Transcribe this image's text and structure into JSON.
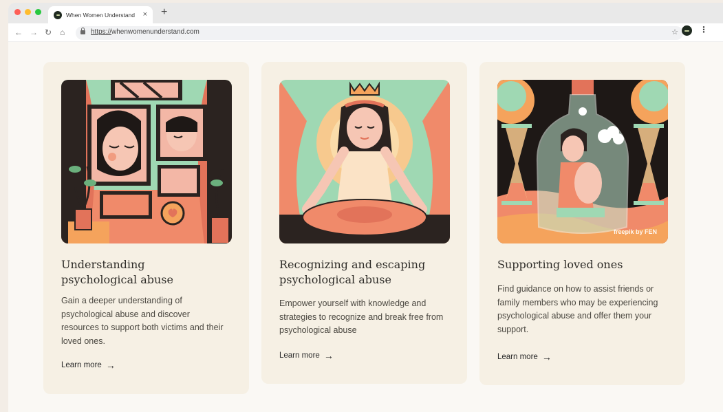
{
  "browser": {
    "tab_title": "When Women Understand",
    "tab_close": "×",
    "new_tab": "+",
    "url_scheme": "https://",
    "url_host": "whenwomenunderstand.com",
    "nav": {
      "back": "←",
      "forward": "→",
      "reload": "↻",
      "home": "⌂",
      "bookmark": "☆",
      "menu": "⋮"
    }
  },
  "cards": [
    {
      "title": "Understanding psychological abuse",
      "text": "Gain a deeper understanding of psychological abuse and discover resources to support both victims and their loved ones.",
      "link": "Learn more"
    },
    {
      "title": "Recognizing and escaping psychological abuse",
      "text": "Empower yourself with knowledge and strategies to recognize and break free from psychological abuse",
      "link": "Learn more"
    },
    {
      "title": "Supporting loved ones",
      "text": "Find guidance on how to assist friends or family members who may be experiencing psychological abuse and offer them your support.",
      "link": "Learn more",
      "image_watermark": "freepik by FEN"
    }
  ],
  "colors": {
    "card_bg": "#f6f0e4",
    "page_bg": "#faf8f4",
    "text_dark": "#2f2d29",
    "illustration_coral": "#f08a6a",
    "illustration_mint": "#9fd8b3",
    "illustration_orange": "#f5a35c"
  }
}
